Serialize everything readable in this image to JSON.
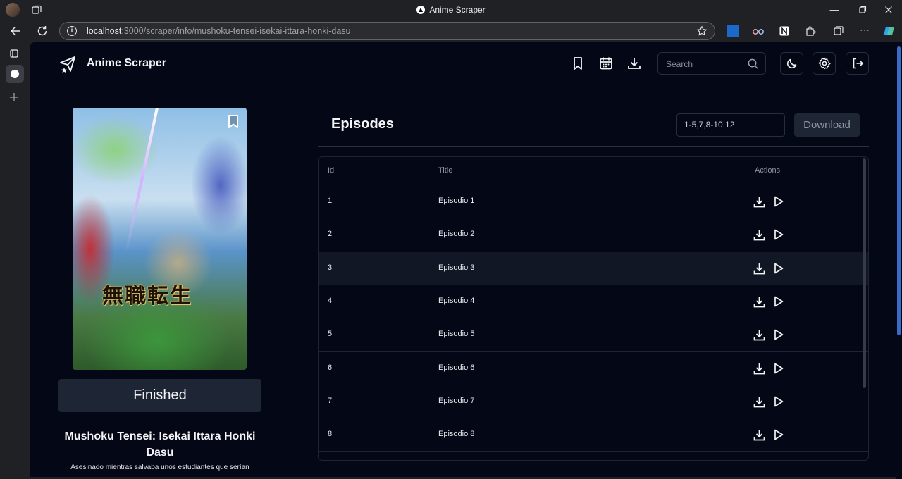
{
  "browser": {
    "window_title": "Anime Scraper",
    "url_host": "localhost",
    "url_rest": ":3000/scraper/info/mushoku-tensei-isekai-ittara-honki-dasu",
    "accent": "#3b6ac8"
  },
  "app": {
    "brand": "Anime Scraper",
    "search_placeholder": "Search"
  },
  "anime": {
    "poster_kanji": "無職転生",
    "status": "Finished",
    "title": "Mushoku Tensei: Isekai Ittara Honki Dasu",
    "description": "Asesinado mientras salvaba unos estudiantes que serían"
  },
  "episodes": {
    "heading": "Episodes",
    "range_value": "1-5,7,8-10,12",
    "download_label": "Download",
    "columns": {
      "id": "Id",
      "title": "Title",
      "actions": "Actions"
    },
    "rows": [
      {
        "id": "1",
        "title": "Episodio 1"
      },
      {
        "id": "2",
        "title": "Episodio 2"
      },
      {
        "id": "3",
        "title": "Episodio 3"
      },
      {
        "id": "4",
        "title": "Episodio 4"
      },
      {
        "id": "5",
        "title": "Episodio 5"
      },
      {
        "id": "6",
        "title": "Episodio 6"
      },
      {
        "id": "7",
        "title": "Episodio 7"
      },
      {
        "id": "8",
        "title": "Episodio 8"
      }
    ]
  }
}
